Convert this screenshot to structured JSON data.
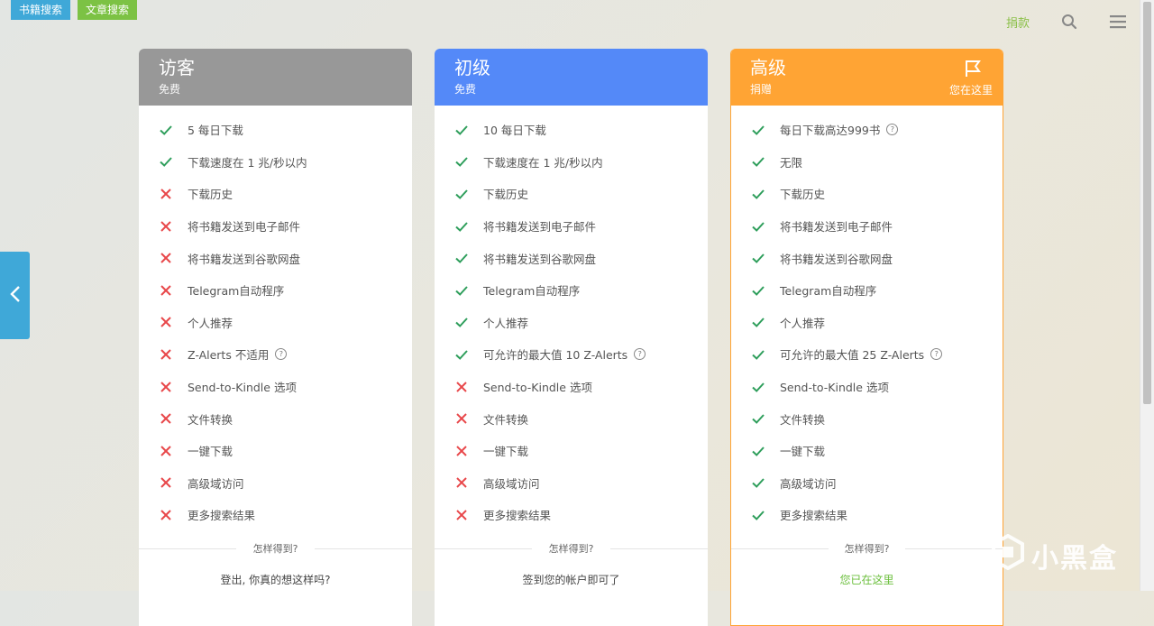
{
  "tabs": {
    "books": "书籍搜索",
    "articles": "文章搜索"
  },
  "header": {
    "donate": "捐款"
  },
  "plans": [
    {
      "name": "访客",
      "subtitle": "免费",
      "features": [
        {
          "text": "5 每日下载",
          "ok": true
        },
        {
          "text": "下载速度在 1 兆/秒以内",
          "ok": true
        },
        {
          "text": "下载历史",
          "ok": false
        },
        {
          "text": "将书籍发送到电子邮件",
          "ok": false
        },
        {
          "text": "将书籍发送到谷歌网盘",
          "ok": false
        },
        {
          "text": "Telegram自动程序",
          "ok": false
        },
        {
          "text": "个人推荐",
          "ok": false
        },
        {
          "text": "Z-Alerts 不适用",
          "ok": false,
          "help": true
        },
        {
          "text": "Send-to-Kindle 选项",
          "ok": false
        },
        {
          "text": "文件转换",
          "ok": false
        },
        {
          "text": "一键下载",
          "ok": false
        },
        {
          "text": "高级域访问",
          "ok": false
        },
        {
          "text": "更多搜索结果",
          "ok": false
        }
      ],
      "how": "怎样得到?",
      "cta": "登出, 你真的想这样吗?"
    },
    {
      "name": "初级",
      "subtitle": "免费",
      "features": [
        {
          "text": "10 每日下载",
          "ok": true
        },
        {
          "text": "下载速度在 1 兆/秒以内",
          "ok": true
        },
        {
          "text": "下载历史",
          "ok": true
        },
        {
          "text": "将书籍发送到电子邮件",
          "ok": true
        },
        {
          "text": "将书籍发送到谷歌网盘",
          "ok": true
        },
        {
          "text": "Telegram自动程序",
          "ok": true
        },
        {
          "text": "个人推荐",
          "ok": true
        },
        {
          "text": "可允许的最大值 10 Z-Alerts",
          "ok": true,
          "help": true
        },
        {
          "text": "Send-to-Kindle 选项",
          "ok": false
        },
        {
          "text": "文件转换",
          "ok": false
        },
        {
          "text": "一键下载",
          "ok": false
        },
        {
          "text": "高级域访问",
          "ok": false
        },
        {
          "text": "更多搜索结果",
          "ok": false
        }
      ],
      "how": "怎样得到?",
      "cta": "签到您的帐户即可了"
    },
    {
      "name": "高级",
      "subtitle": "捐赠",
      "here": "您在这里",
      "features": [
        {
          "text": "每日下载高达999书",
          "ok": true,
          "help": true
        },
        {
          "text": "无限",
          "ok": true
        },
        {
          "text": "下载历史",
          "ok": true
        },
        {
          "text": "将书籍发送到电子邮件",
          "ok": true
        },
        {
          "text": "将书籍发送到谷歌网盘",
          "ok": true
        },
        {
          "text": "Telegram自动程序",
          "ok": true
        },
        {
          "text": "个人推荐",
          "ok": true
        },
        {
          "text": "可允许的最大值 25 Z-Alerts",
          "ok": true,
          "help": true
        },
        {
          "text": "Send-to-Kindle 选项",
          "ok": true
        },
        {
          "text": "文件转换",
          "ok": true
        },
        {
          "text": "一键下载",
          "ok": true
        },
        {
          "text": "高级域访问",
          "ok": true
        },
        {
          "text": "更多搜索结果",
          "ok": true
        }
      ],
      "how": "怎样得到?",
      "cta": "您已在这里"
    }
  ],
  "watermark": "小黑盒",
  "colors": {
    "check": "#2e9e5b",
    "cross": "#e8474a",
    "guest": "#989898",
    "basic": "#5489f8",
    "premium": "#ffa434",
    "tab_books": "#3fa8d8",
    "tab_articles": "#7cc244"
  },
  "icons": {
    "search": "search-icon",
    "menu": "hamburger-menu-icon",
    "flag": "flag-icon",
    "back": "chevron-left-icon"
  }
}
